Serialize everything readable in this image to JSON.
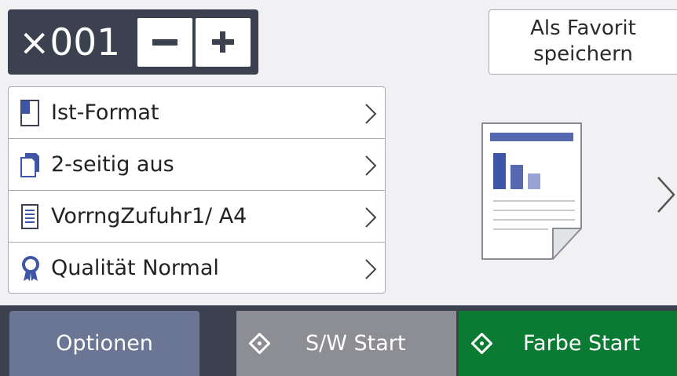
{
  "copies": {
    "value": "×001",
    "decrement_label": "−",
    "increment_label": "+"
  },
  "favorite": {
    "label": "Als Favorit\nspeichern"
  },
  "settings": [
    {
      "icon": "page-size-icon",
      "label": "Ist-Format"
    },
    {
      "icon": "duplex-icon",
      "label": "2-seitig aus"
    },
    {
      "icon": "paper-tray-icon",
      "label": "VorrngZufuhr1/ A4"
    },
    {
      "icon": "quality-ribbon-icon",
      "label": "Qualität Normal"
    }
  ],
  "preview": {
    "icon": "document-preview-icon"
  },
  "bottom": {
    "options_label": "Optionen",
    "mono_start_label": "S/W Start",
    "color_start_label": "Farbe Start"
  },
  "colors": {
    "header_bg": "#3c4150",
    "options_bg": "#6b7694",
    "mono_bg": "#8c8e93",
    "color_bg": "#0b7b34",
    "preview_accent": "#5668b0"
  }
}
